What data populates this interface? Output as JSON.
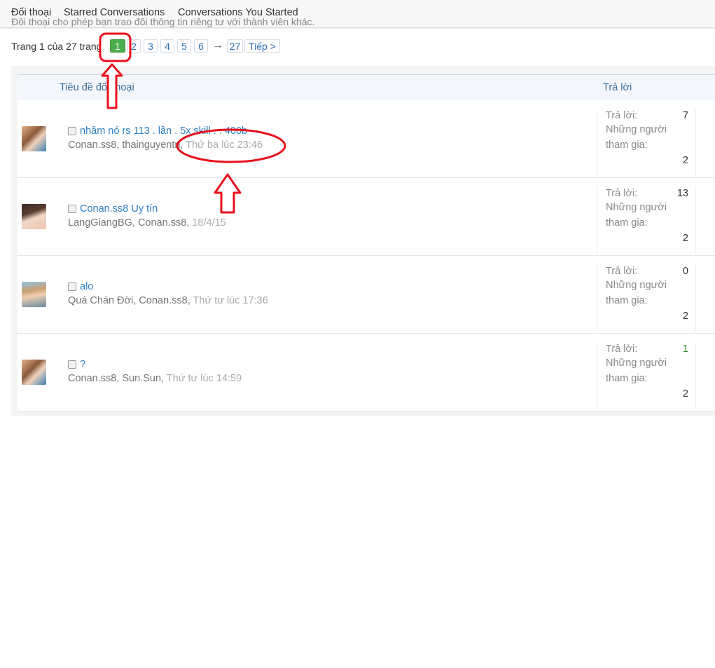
{
  "tabs": [
    {
      "label": "Đối thoại"
    },
    {
      "label": "Starred Conversations"
    },
    {
      "label": "Conversations You Started"
    }
  ],
  "intro_text": "Đối thoại cho phép bạn trao đổi thông tin riêng tư với thành viên khác.",
  "pagination": {
    "label": "Trang 1 của 27 trang",
    "pages": [
      "1",
      "2",
      "3",
      "4",
      "5",
      "6"
    ],
    "arrow": "→",
    "last": "27",
    "next": "Tiếp >"
  },
  "table": {
    "col_title": "Tiêu đề đối thoại",
    "col_replies": "Trả lời"
  },
  "stats_labels": {
    "replies": "Trả lời:",
    "participants_line1": "Những người",
    "participants_line2": "tham gia:"
  },
  "conversations": [
    {
      "title": "nhầm nó rs 113 . lần . 5x skill . . 400b",
      "participants": "Conan.ss8, thainguyentn,",
      "time": "Thứ ba lúc 23:46",
      "replies": "7",
      "participant_count": "2"
    },
    {
      "title": "Conan.ss8 Uy tín",
      "participants": "LangGiangBG, Conan.ss8,",
      "time": "18/4/15",
      "replies": "13",
      "participant_count": "2"
    },
    {
      "title": "alo",
      "participants": "Quá Chán Đời, Conan.ss8,",
      "time": "Thứ tư lúc 17:36",
      "replies": "0",
      "participant_count": "2"
    },
    {
      "title": "?",
      "participants": "Conan.ss8, Sun.Sun,",
      "time": "Thứ tư lúc 14:59",
      "replies": "1",
      "participant_count": "2"
    }
  ],
  "colors": {
    "accent": "#2f7ec2",
    "current_page": "#4cae4c",
    "annotation": "#e8101c"
  }
}
